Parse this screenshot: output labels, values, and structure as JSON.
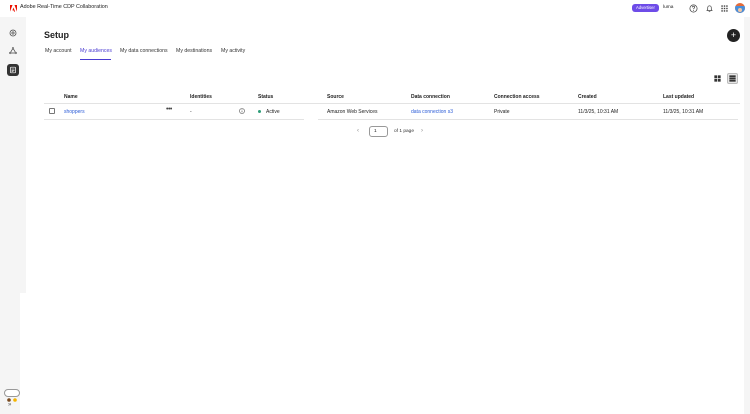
{
  "header": {
    "app_title": "Adobe Real-Time CDP Collaboration",
    "role_badge": "Advertiser",
    "sandbox_name": "luma",
    "icons": [
      "help-icon",
      "bell-icon",
      "apps-grid-icon"
    ]
  },
  "rail": {
    "items": [
      {
        "icon": "home-icon"
      },
      {
        "icon": "connections-icon"
      },
      {
        "icon": "setup-icon",
        "active": true
      }
    ]
  },
  "page": {
    "title": "Setup",
    "add_label": "+"
  },
  "tabs": [
    {
      "label": "My account"
    },
    {
      "label": "My audiences",
      "selected": true
    },
    {
      "label": "My data connections"
    },
    {
      "label": "My destinations"
    },
    {
      "label": "My activity"
    }
  ],
  "table": {
    "columns": [
      "Name",
      "Identities",
      "Status",
      "Source",
      "Data connection",
      "Connection access",
      "Created",
      "Last updated"
    ],
    "rows": [
      {
        "name": "shoppers",
        "identities": "-",
        "status": "Active",
        "source": "Amazon Web Services",
        "data_connection": "data connection s3",
        "connection_access": "Private",
        "created": "11/3/25, 10:31 AM",
        "last_updated": "11/3/25, 10:31 AM"
      }
    ]
  },
  "pagination": {
    "current_page": "1",
    "of_label": "of 1 page"
  },
  "colors": {
    "accent": "#4a3bd1",
    "badge": "#6e4ce8",
    "link": "#2a5bd7",
    "active_status": "#2d9d78"
  }
}
